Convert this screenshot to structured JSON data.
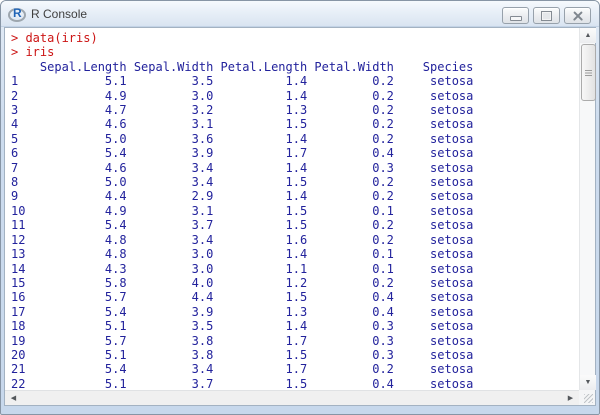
{
  "window": {
    "title": "R Console",
    "icon_letter": "R"
  },
  "titlebar": {
    "buttons": [
      "minimize",
      "restore",
      "close"
    ]
  },
  "colors": {
    "input_text": "#CC1414",
    "output_text": "#22229C",
    "console_background": "#FFFFFF",
    "frame": "#C7D8EC"
  },
  "console": {
    "prompt_lines": [
      "> data(iris)",
      "> iris"
    ],
    "table": {
      "index_column_width": 3,
      "columns": [
        {
          "name": "Sepal.Length",
          "width": 12
        },
        {
          "name": "Sepal.Width",
          "width": 11
        },
        {
          "name": "Petal.Length",
          "width": 12
        },
        {
          "name": "Petal.Width",
          "width": 11
        },
        {
          "name": "Species",
          "width": 10
        }
      ],
      "rows": [
        {
          "index": "1",
          "values": [
            "5.1",
            "3.5",
            "1.4",
            "0.2",
            "setosa"
          ]
        },
        {
          "index": "2",
          "values": [
            "4.9",
            "3.0",
            "1.4",
            "0.2",
            "setosa"
          ]
        },
        {
          "index": "3",
          "values": [
            "4.7",
            "3.2",
            "1.3",
            "0.2",
            "setosa"
          ]
        },
        {
          "index": "4",
          "values": [
            "4.6",
            "3.1",
            "1.5",
            "0.2",
            "setosa"
          ]
        },
        {
          "index": "5",
          "values": [
            "5.0",
            "3.6",
            "1.4",
            "0.2",
            "setosa"
          ]
        },
        {
          "index": "6",
          "values": [
            "5.4",
            "3.9",
            "1.7",
            "0.4",
            "setosa"
          ]
        },
        {
          "index": "7",
          "values": [
            "4.6",
            "3.4",
            "1.4",
            "0.3",
            "setosa"
          ]
        },
        {
          "index": "8",
          "values": [
            "5.0",
            "3.4",
            "1.5",
            "0.2",
            "setosa"
          ]
        },
        {
          "index": "9",
          "values": [
            "4.4",
            "2.9",
            "1.4",
            "0.2",
            "setosa"
          ]
        },
        {
          "index": "10",
          "values": [
            "4.9",
            "3.1",
            "1.5",
            "0.1",
            "setosa"
          ]
        },
        {
          "index": "11",
          "values": [
            "5.4",
            "3.7",
            "1.5",
            "0.2",
            "setosa"
          ]
        },
        {
          "index": "12",
          "values": [
            "4.8",
            "3.4",
            "1.6",
            "0.2",
            "setosa"
          ]
        },
        {
          "index": "13",
          "values": [
            "4.8",
            "3.0",
            "1.4",
            "0.1",
            "setosa"
          ]
        },
        {
          "index": "14",
          "values": [
            "4.3",
            "3.0",
            "1.1",
            "0.1",
            "setosa"
          ]
        },
        {
          "index": "15",
          "values": [
            "5.8",
            "4.0",
            "1.2",
            "0.2",
            "setosa"
          ]
        },
        {
          "index": "16",
          "values": [
            "5.7",
            "4.4",
            "1.5",
            "0.4",
            "setosa"
          ]
        },
        {
          "index": "17",
          "values": [
            "5.4",
            "3.9",
            "1.3",
            "0.4",
            "setosa"
          ]
        },
        {
          "index": "18",
          "values": [
            "5.1",
            "3.5",
            "1.4",
            "0.3",
            "setosa"
          ]
        },
        {
          "index": "19",
          "values": [
            "5.7",
            "3.8",
            "1.7",
            "0.3",
            "setosa"
          ]
        },
        {
          "index": "20",
          "values": [
            "5.1",
            "3.8",
            "1.5",
            "0.3",
            "setosa"
          ]
        },
        {
          "index": "21",
          "values": [
            "5.4",
            "3.4",
            "1.7",
            "0.2",
            "setosa"
          ]
        },
        {
          "index": "22",
          "values": [
            "5.1",
            "3.7",
            "1.5",
            "0.4",
            "setosa"
          ]
        }
      ]
    }
  }
}
